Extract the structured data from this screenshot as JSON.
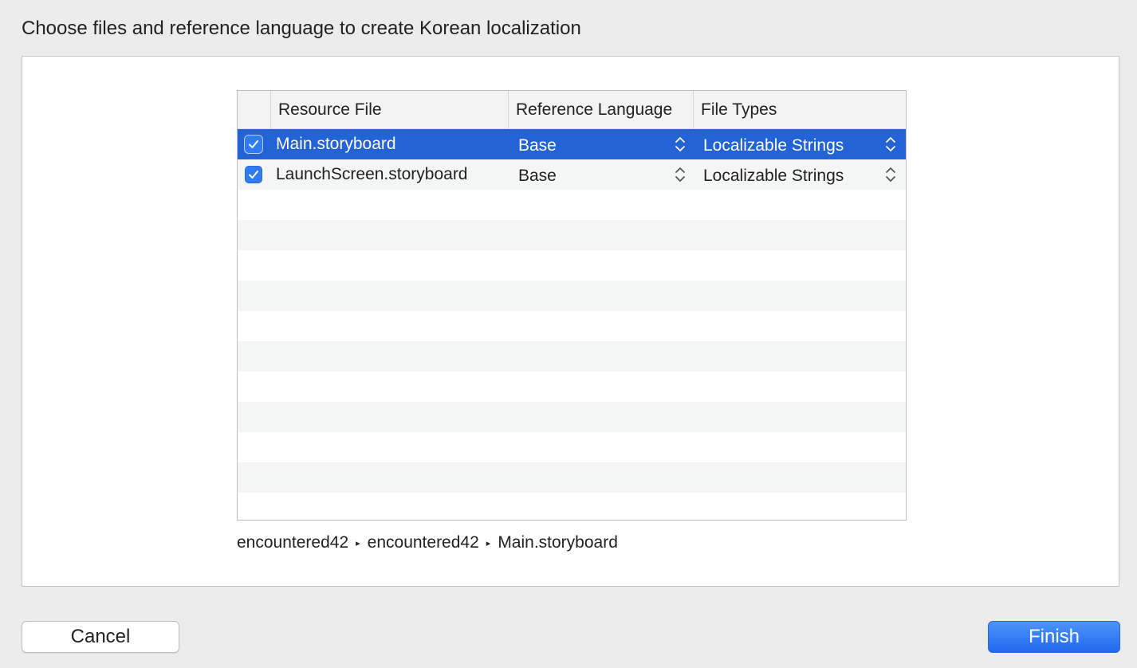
{
  "dialog": {
    "title": "Choose files and reference language to create Korean localization"
  },
  "table": {
    "columns": {
      "resource_file": "Resource File",
      "reference_language": "Reference Language",
      "file_types": "File Types"
    },
    "rows": [
      {
        "checked": true,
        "file": "Main.storyboard",
        "language": "Base",
        "type": "Localizable Strings",
        "selected": true
      },
      {
        "checked": true,
        "file": "LaunchScreen.storyboard",
        "language": "Base",
        "type": "Localizable Strings",
        "selected": false
      }
    ]
  },
  "path_bar": {
    "segments": [
      "encountered42",
      "encountered42",
      "Main.storyboard"
    ],
    "separator_icon": "triangle-right-icon"
  },
  "buttons": {
    "cancel": "Cancel",
    "finish": "Finish"
  },
  "colors": {
    "selection": "#2463d5",
    "accent": "#2f7bf5"
  },
  "icons": {
    "checkbox": "checkmark-icon",
    "stepper": "up-down-chevron-icon"
  }
}
